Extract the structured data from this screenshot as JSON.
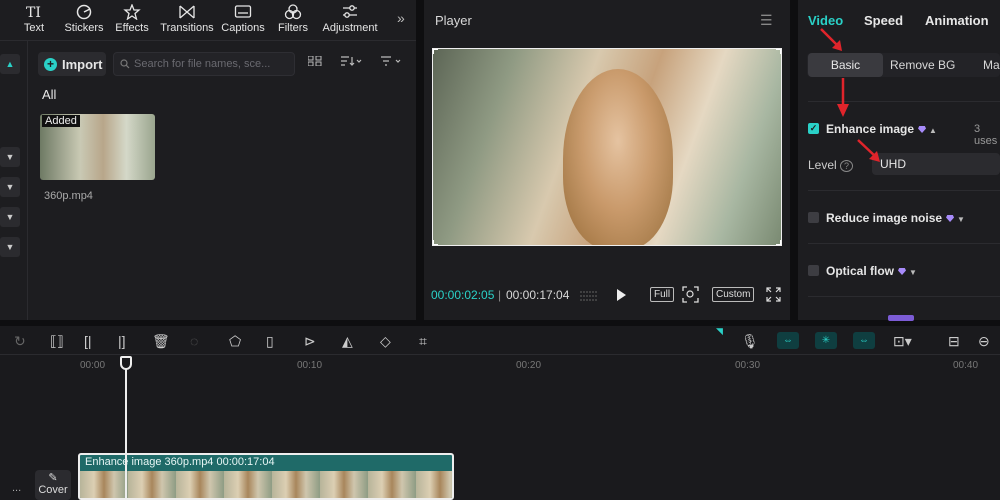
{
  "toolbar": {
    "tools": [
      {
        "label": "Text",
        "icon": "text-icon"
      },
      {
        "label": "Stickers",
        "icon": "sticker-icon"
      },
      {
        "label": "Effects",
        "icon": "effects-icon"
      },
      {
        "label": "Transitions",
        "icon": "transitions-icon"
      },
      {
        "label": "Captions",
        "icon": "captions-icon"
      },
      {
        "label": "Filters",
        "icon": "filters-icon"
      },
      {
        "label": "Adjustment",
        "icon": "adjustment-icon"
      }
    ],
    "more": "»"
  },
  "media": {
    "import_label": "Import",
    "search_placeholder": "Search for file names, sce...",
    "filter_all": "All",
    "items": [
      {
        "badge": "Added",
        "name": "360p.mp4"
      }
    ]
  },
  "player": {
    "title": "Player",
    "current_time": "00:00:02:05",
    "separator": "|",
    "total_time": "00:00:17:04",
    "full_label": "Full",
    "ratio_label": "Custom"
  },
  "properties": {
    "tabs": [
      "Video",
      "Speed",
      "Animation"
    ],
    "subtabs": [
      "Basic",
      "Remove BG",
      "Ma"
    ],
    "enhance": {
      "label": "Enhance image",
      "checked": true,
      "uses": "3 uses"
    },
    "level": {
      "label": "Level",
      "value": "UHD"
    },
    "reduce_noise": {
      "label": "Reduce image noise",
      "checked": false
    },
    "optical_flow": {
      "label": "Optical flow",
      "checked": false
    },
    "accent": "#2ad1c7",
    "pro_color": "#a78bfa",
    "annotation_color": "#e0242b"
  },
  "timeline": {
    "ruler": [
      "00:00",
      "00:10",
      "00:20",
      "00:30",
      "00:40"
    ],
    "clip_label": "Enhance image  360p.mp4  00:00:17:04",
    "cover_label": "Cover",
    "dots": "..."
  }
}
